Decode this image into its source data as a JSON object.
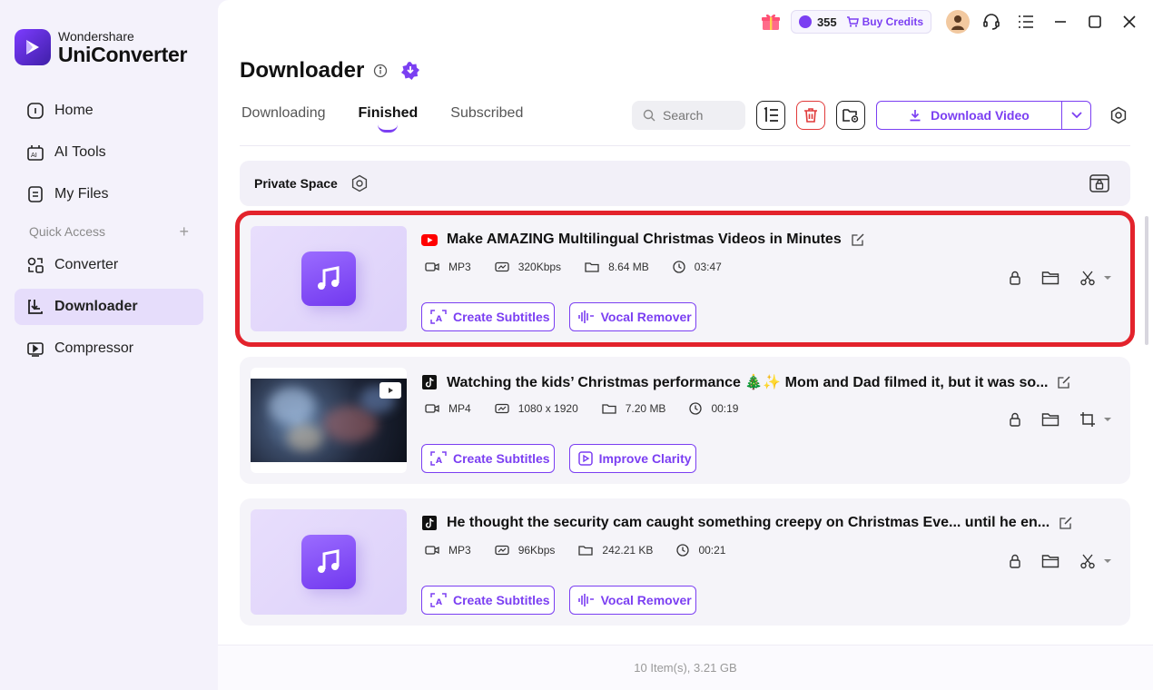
{
  "app": {
    "brand": "Wondershare",
    "product": "UniConverter"
  },
  "sidebar": {
    "items": [
      {
        "label": "Home",
        "icon": "home-icon"
      },
      {
        "label": "AI Tools",
        "icon": "ai-tools-icon"
      },
      {
        "label": "My Files",
        "icon": "files-icon"
      }
    ],
    "quick_access_label": "Quick Access",
    "quick_items": [
      {
        "label": "Converter",
        "icon": "converter-icon"
      },
      {
        "label": "Downloader",
        "icon": "downloader-icon",
        "active": true
      },
      {
        "label": "Compressor",
        "icon": "compressor-icon"
      }
    ]
  },
  "titlebar": {
    "credits": "355",
    "buy_credits": "Buy Credits"
  },
  "page": {
    "title": "Downloader"
  },
  "tabs": [
    {
      "label": "Downloading"
    },
    {
      "label": "Finished",
      "active": true
    },
    {
      "label": "Subscribed"
    }
  ],
  "toolbar": {
    "search_placeholder": "Search",
    "download_video": "Download Video"
  },
  "private_space": {
    "label": "Private Space"
  },
  "items": [
    {
      "source": "youtube",
      "title": "Make AMAZING Multilingual Christmas Videos in Minutes",
      "format": "MP3",
      "quality": "320Kbps",
      "size": "8.64 MB",
      "duration": "03:47",
      "thumb": "audio",
      "actions": [
        "Create Subtitles",
        "Vocal Remover"
      ],
      "tool_icon": "scissors-icon",
      "highlighted": true
    },
    {
      "source": "tiktok",
      "title": "Watching the kids’ Christmas performance 🎄✨ Mom and Dad filmed it, but it was so...",
      "format": "MP4",
      "quality": "1080 x 1920",
      "size": "7.20 MB",
      "duration": "00:19",
      "thumb": "video",
      "actions": [
        "Create Subtitles",
        "Improve Clarity"
      ],
      "tool_icon": "crop-icon",
      "highlighted": false
    },
    {
      "source": "tiktok",
      "title": "He thought the security cam caught something creepy on Christmas Eve... until he en...",
      "format": "MP3",
      "quality": "96Kbps",
      "size": "242.21 KB",
      "duration": "00:21",
      "thumb": "audio",
      "actions": [
        "Create Subtitles",
        "Vocal Remover"
      ],
      "tool_icon": "scissors-icon",
      "highlighted": false
    }
  ],
  "footer": {
    "summary": "10 Item(s), 3.21 GB"
  },
  "colors": {
    "accent": "#7b3ff2",
    "highlight": "#e3232c",
    "youtube": "#ff0000"
  }
}
